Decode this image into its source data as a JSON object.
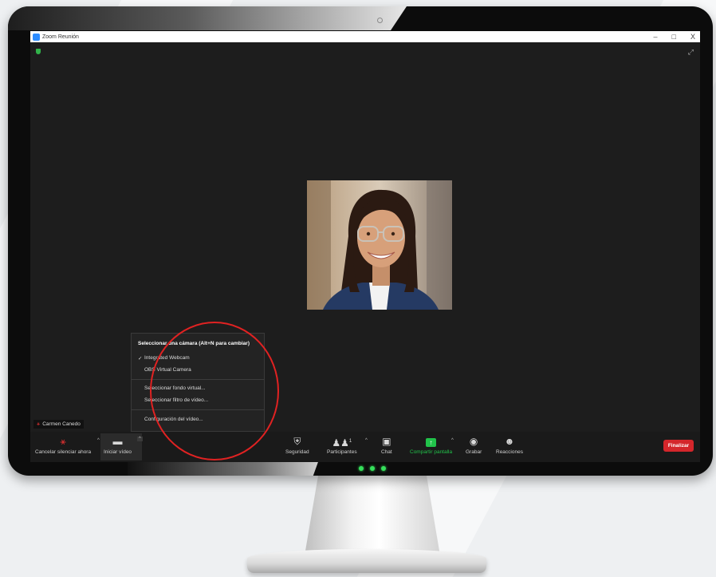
{
  "window": {
    "title": "Zoom Reunión",
    "minimize": "–",
    "maximize": "□",
    "close": "X"
  },
  "participant": {
    "name": "Carmen Canedo"
  },
  "camera_menu": {
    "title": "Seleccionar una cámara (Alt+N para cambiar)",
    "cameras": [
      "Integrated Webcam",
      "OBS Virtual Camera"
    ],
    "selected_camera": "Integrated Webcam",
    "check_mark": "✓",
    "actions": [
      "Seleccionar fondo virtual...",
      "Seleccionar filtro de vídeo..."
    ],
    "settings": "Configuración del vídeo..."
  },
  "toolbar": {
    "unmute_label": "Cancelar silenciar ahora",
    "video_label": "Iniciar vídeo",
    "security_label": "Seguridad",
    "participants_label": "Participantes",
    "participants_count": "1",
    "chat_label": "Chat",
    "share_label": "Compartir pantalla",
    "record_label": "Grabar",
    "reactions_label": "Reacciones",
    "end_label": "Finalizar"
  },
  "colors": {
    "accent_share": "#21c24a",
    "end_button": "#d4262b",
    "annotation_circle": "#e02222",
    "zoom_blue": "#2d8cff"
  }
}
